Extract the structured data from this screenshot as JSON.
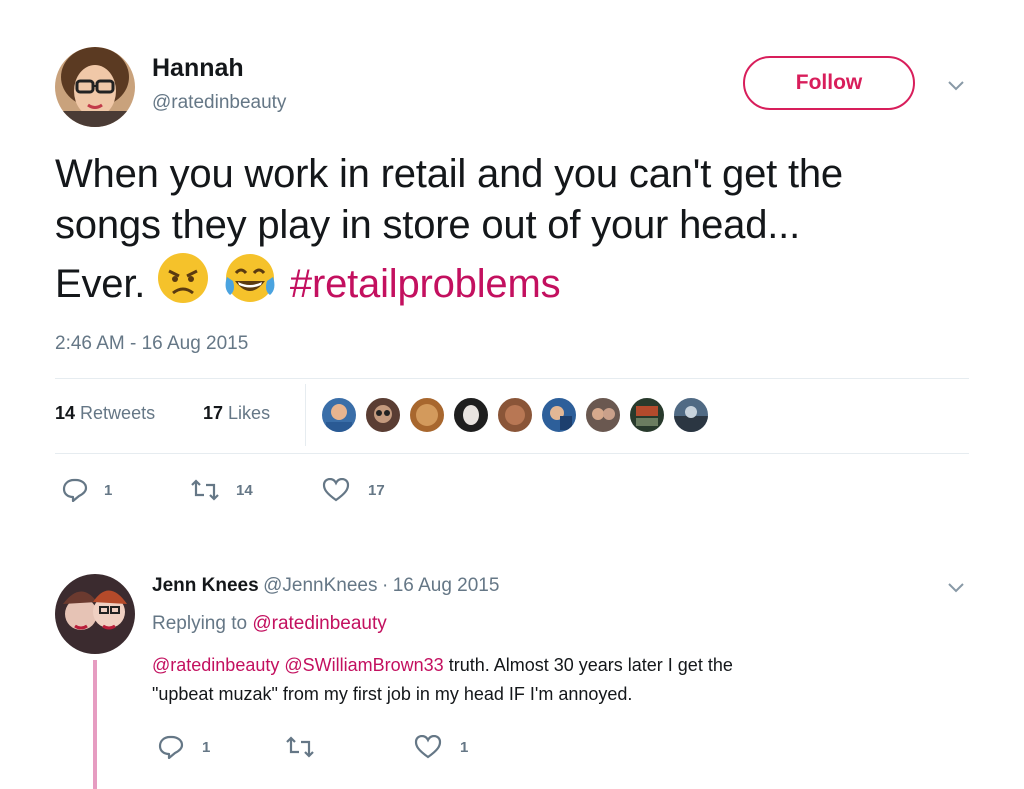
{
  "tweet": {
    "author_name": "Hannah",
    "author_handle": "@ratedinbeauty",
    "follow_label": "Follow",
    "text_line1": "When you work in retail and you can't get the",
    "text_line2": "songs they play in store out of your head...",
    "text_line3_start": "Ever.",
    "emoji_1": "😠",
    "emoji_2": "😂",
    "hashtag": "#retailproblems",
    "timestamp": "2:46 AM - 16 Aug 2015",
    "retweets_count": "14",
    "retweets_label": "Retweets",
    "likes_count": "17",
    "likes_label": "Likes",
    "actions": {
      "reply_count": "1",
      "retweet_count": "14",
      "like_count": "17"
    }
  },
  "reply": {
    "author_name": "Jenn Knees",
    "author_handle": "@JennKnees",
    "separator": "·",
    "date": "16 Aug 2015",
    "replying_prefix": "Replying to",
    "replying_to": "@ratedinbeauty",
    "mention_1": "@ratedinbeauty",
    "mention_2": "@SWilliamBrown33",
    "text_line1_rest": "truth. Almost 30 years later I get the",
    "text_line2": "\"upbeat muzak\" from my first job in my head IF I'm annoyed.",
    "actions": {
      "reply_count": "1",
      "like_count": "1"
    }
  },
  "colors": {
    "accent": "#c3105f",
    "follow_border": "#d81e5b",
    "muted": "#657786",
    "thread_line": "#e69cc1"
  },
  "icons": [
    "chevron-down-icon",
    "reply-icon",
    "retweet-icon",
    "heart-icon"
  ]
}
